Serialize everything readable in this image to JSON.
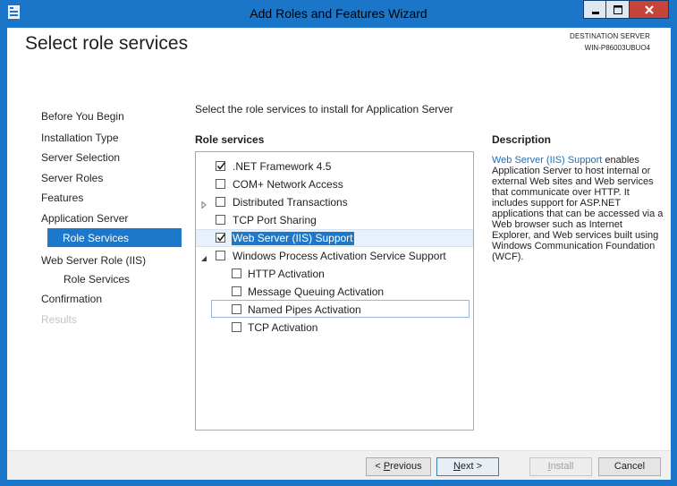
{
  "window": {
    "title": "Add Roles and Features Wizard"
  },
  "page": {
    "title": "Select role services",
    "destination_label": "DESTINATION SERVER",
    "destination_server": "WIN-P86003UBUO4"
  },
  "nav": {
    "items": [
      {
        "label": "Before You Begin"
      },
      {
        "label": "Installation Type"
      },
      {
        "label": "Server Selection"
      },
      {
        "label": "Server Roles"
      },
      {
        "label": "Features"
      },
      {
        "label": "Application Server"
      },
      {
        "label": "Role Services"
      },
      {
        "label": "Web Server Role (IIS)"
      },
      {
        "label": "Role Services"
      },
      {
        "label": "Confirmation"
      },
      {
        "label": "Results"
      }
    ],
    "selected_index": 6
  },
  "main": {
    "instruction": "Select the role services to install for Application Server",
    "role_services_header": "Role services",
    "tree": [
      {
        "label": ".NET Framework 4.5",
        "checked": true,
        "level": 0
      },
      {
        "label": "COM+ Network Access",
        "checked": false,
        "level": 0
      },
      {
        "label": "Distributed Transactions",
        "checked": false,
        "level": 0,
        "expander": "collapsed"
      },
      {
        "label": "TCP Port Sharing",
        "checked": false,
        "level": 0
      },
      {
        "label": "Web Server (IIS) Support",
        "checked": true,
        "level": 0,
        "selected": true
      },
      {
        "label": "Windows Process Activation Service Support",
        "checked": false,
        "level": 0,
        "expander": "expanded"
      },
      {
        "label": "HTTP Activation",
        "checked": false,
        "level": 1
      },
      {
        "label": "Message Queuing Activation",
        "checked": false,
        "level": 1
      },
      {
        "label": "Named Pipes Activation",
        "checked": false,
        "level": 1,
        "focused": true
      },
      {
        "label": "TCP Activation",
        "checked": false,
        "level": 1
      }
    ]
  },
  "description": {
    "header": "Description",
    "link_text": "Web Server (IIS) Support",
    "body": " enables Application Server to host internal or external Web sites and Web services that communicate over HTTP. It includes support for ASP.NET applications that can be accessed via a Web browser such as Internet Explorer, and Web services built using Windows Communication Foundation (WCF)."
  },
  "buttons": {
    "previous": {
      "prefix": "< ",
      "mnemonic": "P",
      "rest": "revious"
    },
    "next": {
      "mnemonic": "N",
      "rest": "ext >"
    },
    "install": {
      "mnemonic": "I",
      "rest": "nstall"
    },
    "cancel": {
      "label": "Cancel"
    }
  },
  "colors": {
    "accent": "#1d78c9",
    "frame": "#1b76c9",
    "close": "#c7443a"
  }
}
